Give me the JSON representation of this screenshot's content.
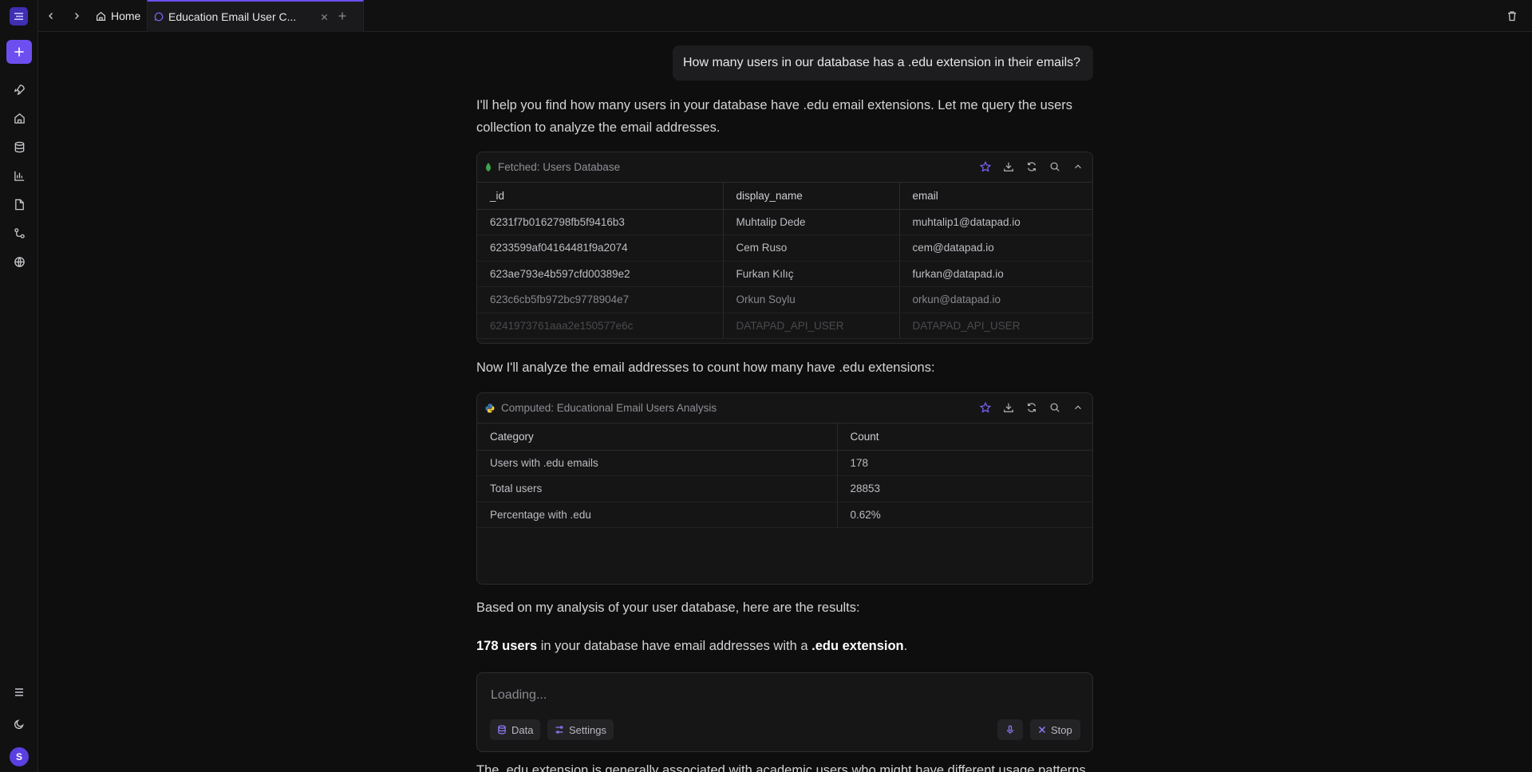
{
  "tabs": {
    "home_label": "Home",
    "active_label": "Education Email User C..."
  },
  "chat": {
    "user_message": "How many users in our database has a .edu extension in their emails?",
    "intro": "I'll help you find how many users in your database have .edu email extensions. Let me query the users collection to analyze the email addresses.",
    "mid": "Now I'll analyze the email addresses to count how many have .edu extensions:",
    "results_intro": "Based on my analysis of your user database, here are the results:",
    "result_bold_1": "178 users",
    "result_mid": " in your database have email addresses with a ",
    "result_bold_2": ".edu extension",
    "result_end": ".",
    "tail": "The .edu extension is generally associated with academic users who might have different usage patterns"
  },
  "fetched_card": {
    "title": "Fetched: Users Database",
    "columns": [
      "_id",
      "display_name",
      "email"
    ],
    "rows": [
      [
        "6231f7b0162798fb5f9416b3",
        "Muhtalip Dede",
        "muhtalip1@datapad.io"
      ],
      [
        "6233599af04164481f9a2074",
        "Cem Ruso",
        "cem@datapad.io"
      ],
      [
        "623ae793e4b597cfd00389e2",
        "Furkan Kılıç",
        "furkan@datapad.io"
      ],
      [
        "623c6cb5fb972bc9778904e7",
        "Orkun Soylu",
        "orkun@datapad.io"
      ],
      [
        "6241973761aaa2e150577e6c",
        "DATAPAD_API_USER",
        "DATAPAD_API_USER"
      ]
    ]
  },
  "computed_card": {
    "title": "Computed: Educational Email Users Analysis",
    "columns": [
      "Category",
      "Count"
    ],
    "rows": [
      [
        "Users with .edu emails",
        "178"
      ],
      [
        "Total users",
        "28853"
      ],
      [
        "Percentage with .edu",
        "0.62%"
      ]
    ]
  },
  "composer": {
    "placeholder": "Loading...",
    "data_label": "Data",
    "settings_label": "Settings",
    "stop_label": "Stop"
  },
  "user": {
    "avatar_initial": "S"
  },
  "colors": {
    "accent": "#6d4ff0",
    "background": "#0e0e0f",
    "mongo_leaf": "#3fa34d"
  }
}
